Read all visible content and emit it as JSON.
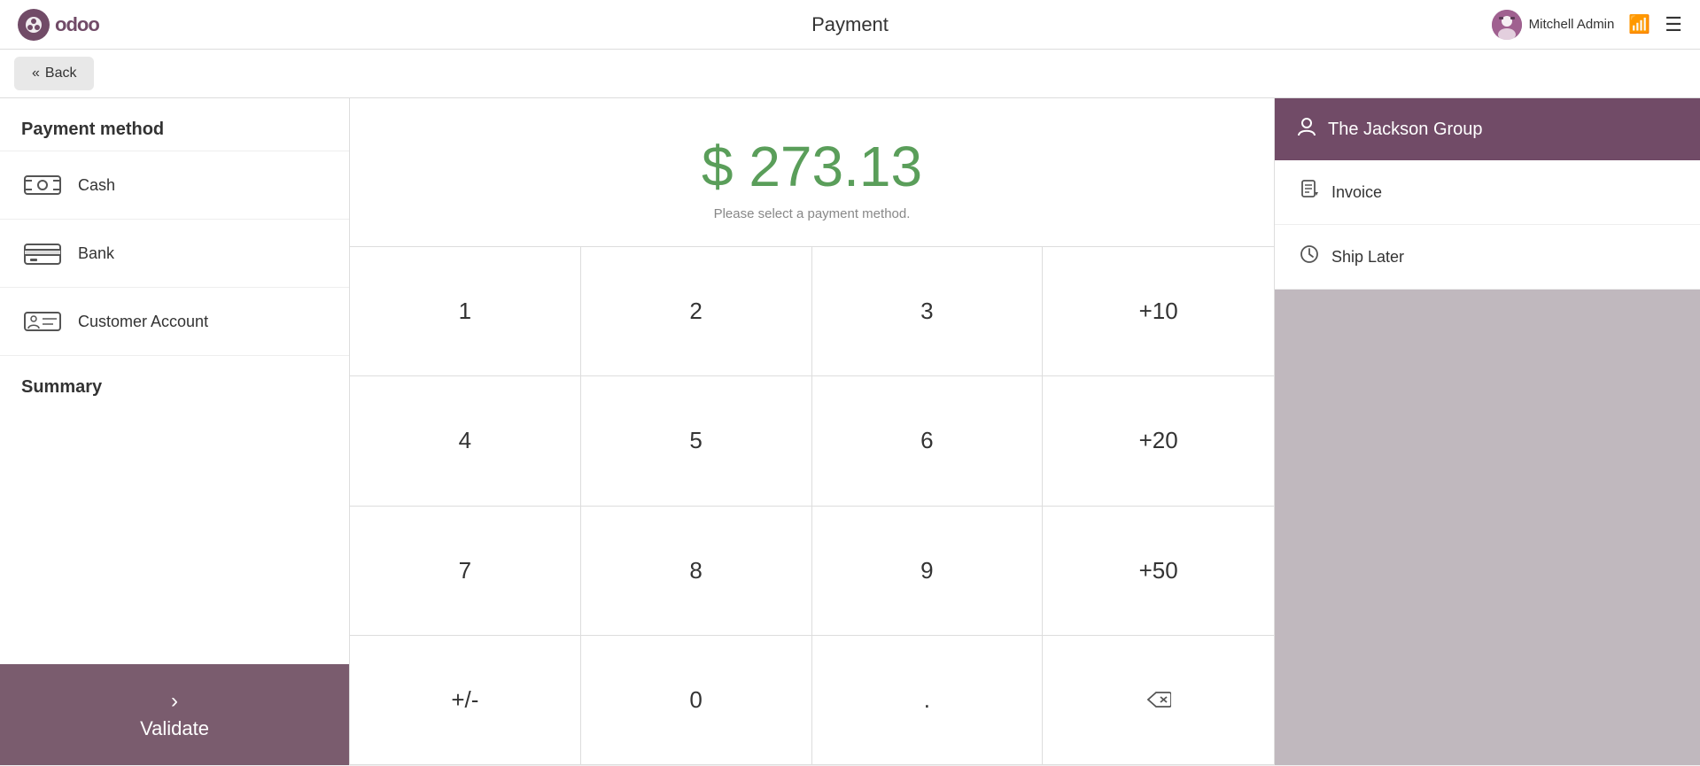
{
  "app": {
    "logo_text": "odoo"
  },
  "topnav": {
    "page_title": "Payment",
    "user_name": "Mitchell Admin",
    "user_emoji": "🧑‍💼"
  },
  "back_button": {
    "label": "Back"
  },
  "left_panel": {
    "payment_method_title": "Payment method",
    "methods": [
      {
        "id": "cash",
        "label": "Cash",
        "icon": "cash"
      },
      {
        "id": "bank",
        "label": "Bank",
        "icon": "bank"
      },
      {
        "id": "customer_account",
        "label": "Customer Account",
        "icon": "customer"
      }
    ],
    "summary_title": "Summary",
    "validate_label": "Validate"
  },
  "center_panel": {
    "amount": "$ 273.13",
    "hint": "Please select a payment method.",
    "keys": [
      {
        "label": "1",
        "value": "1"
      },
      {
        "label": "2",
        "value": "2"
      },
      {
        "label": "3",
        "value": "3"
      },
      {
        "label": "+10",
        "value": "+10"
      },
      {
        "label": "4",
        "value": "4"
      },
      {
        "label": "5",
        "value": "5"
      },
      {
        "label": "6",
        "value": "6"
      },
      {
        "label": "+20",
        "value": "+20"
      },
      {
        "label": "7",
        "value": "7"
      },
      {
        "label": "8",
        "value": "8"
      },
      {
        "label": "9",
        "value": "9"
      },
      {
        "label": "+50",
        "value": "+50"
      },
      {
        "label": "+/-",
        "value": "+/-"
      },
      {
        "label": "0",
        "value": "0"
      },
      {
        "label": ".",
        "value": "."
      },
      {
        "label": "⌫",
        "value": "backspace"
      }
    ]
  },
  "right_panel": {
    "customer_name": "The Jackson Group",
    "actions": [
      {
        "id": "invoice",
        "label": "Invoice",
        "icon": "📄"
      },
      {
        "id": "ship_later",
        "label": "Ship Later",
        "icon": "🕐"
      }
    ]
  },
  "colors": {
    "accent": "#714b67",
    "amount_green": "#5a9e5a",
    "validate_bg": "#7a5c6e"
  }
}
